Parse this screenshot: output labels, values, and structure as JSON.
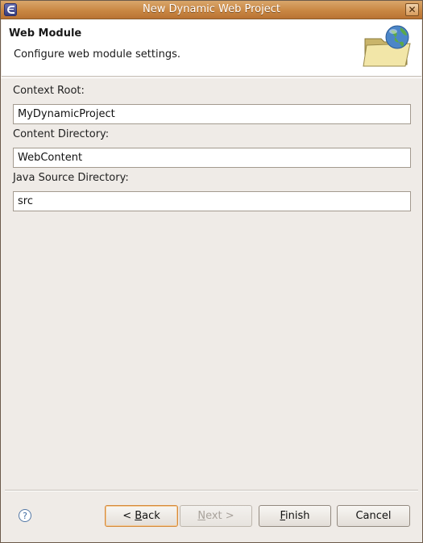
{
  "window": {
    "title": "New Dynamic Web Project"
  },
  "header": {
    "title": "Web Module",
    "description": "Configure web module settings."
  },
  "fields": [
    {
      "label": "Context Root:",
      "value": "MyDynamicProject"
    },
    {
      "label": "Content Directory:",
      "value": "WebContent"
    },
    {
      "label": "Java Source Directory:",
      "value": "src"
    }
  ],
  "buttons": {
    "back": {
      "prefix": "< ",
      "mnemonic": "B",
      "rest": "ack"
    },
    "next": {
      "mnemonic": "N",
      "rest": "ext >"
    },
    "finish": {
      "mnemonic": "F",
      "rest": "inish"
    },
    "cancel": "Cancel"
  },
  "help": {
    "glyph": "?"
  },
  "icons": {
    "app": "eclipse-icon",
    "close": "close-icon",
    "wizard": "folder-globe-icon",
    "help": "help-icon"
  },
  "colors": {
    "titlebar": "#c98743",
    "dialog_bg": "#efebe7",
    "default_button_border": "#d68a3c"
  }
}
